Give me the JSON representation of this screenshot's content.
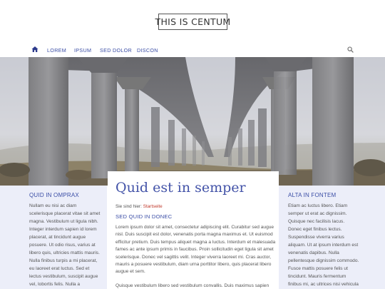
{
  "site": {
    "logo": "THIS IS CENTUM"
  },
  "nav": {
    "home_icon": "home-icon",
    "items": [
      {
        "label": "LOREM"
      },
      {
        "label": "IPSUM"
      },
      {
        "label": "SED DOLOR"
      },
      {
        "label": "DISCON"
      }
    ],
    "search_icon": "search-icon"
  },
  "hero": {
    "image": "concrete highway viaduct in fog"
  },
  "left_sidebar": {
    "title": "QUID IN OMPRAX",
    "text": "Nullam eu nisi ac diam scelerisque placerat vitae sit amet magna. Vestibulum ut ligula nibh. Integer interdum sapien id lorem placerat, at tincidunt augue posuere. Ut odio risus, varius at libero quis, ultricies mattis mauris. Nulla finibus turpis a mi placerat, eu laoreet erat luctus. Sed et lectus vestibulum, suscipit augue vel, lobortis felis. Nulla a"
  },
  "main": {
    "title": "Quid est in semper",
    "breadcrumb_prefix": "Sie sind hier: ",
    "breadcrumb_link": "Startseite",
    "subtitle": "SED QUID IN DONEC",
    "paragraph1": "Lorem ipsum dolor sit amet, consectetur adipiscing elit. Curabitur sed augue nisl. Duis suscipit est dolor, venenatis porta magna maximus et. Ut euismod efficitur pretium. Duis tempus aliquet magna a luctus. Interdum et malesuada fames ac ante ipsum primis in faucibus. Proin sollicitudin eget ligula sit amet scelerisque. Donec vel sagittis velit. Integer viverra laoreet mi. Cras auctor, mauris a posuere vestibulum, diam urna porttitor libero, quis placerat libero augue et sem.",
    "paragraph2": "Quisque vestibulum libero sed vestibulum convallis. Duis maximus sapien"
  },
  "right_sidebar": {
    "title": "ALTA IN FONTEM",
    "text": "Etiam ac luctus libero. Etiam semper ut erat ac dignissim. Quisque nec facilisis lacus. Donec eget finibus lectus. Suspendisse viverra varius aliquam. Ut at ipsum interdum est venenatis dapibus. Nulla pellentesque dignissim commodo. Fusce mattis posuere felis ut tincidunt. Mauris fermentum finibus mi, ac ultrices nisi vehicula nec."
  },
  "colors": {
    "accent": "#3b4ea6",
    "sidebar_bg": "#eceef9",
    "link": "#c0392b"
  }
}
